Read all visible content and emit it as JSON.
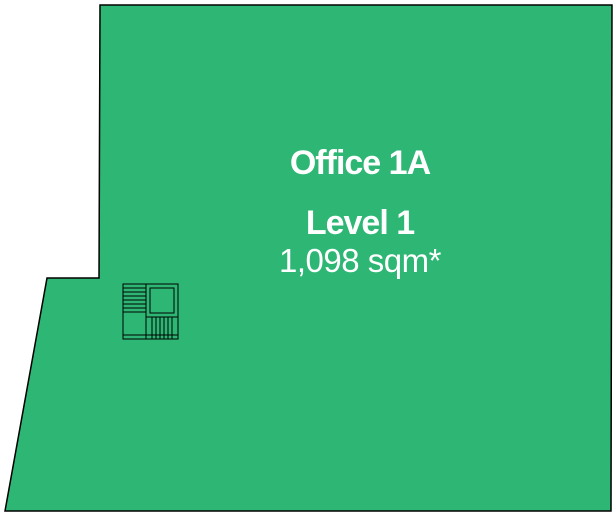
{
  "floor_plan": {
    "fill_color": "#2db674",
    "stroke_color": "#000000",
    "unit": {
      "name": "Office 1A",
      "level": "Level 1",
      "area": "1,098 sqm*"
    },
    "icons": [
      "staircase-icon"
    ]
  }
}
